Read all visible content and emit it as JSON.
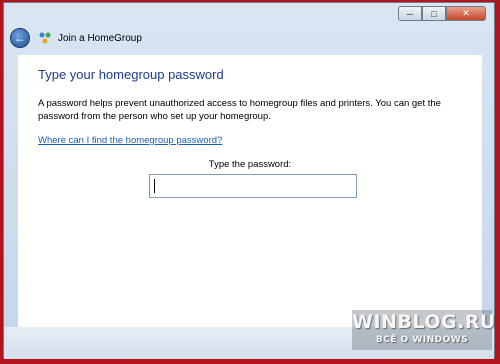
{
  "window": {
    "controls": {
      "minimize_icon": "minimize-icon",
      "maximize_icon": "maximize-icon",
      "close_icon": "close-icon"
    }
  },
  "nav": {
    "back_icon": "back-arrow-icon",
    "app_icon": "homegroup-icon",
    "title": "Join a HomeGroup"
  },
  "main": {
    "heading": "Type your homegroup password",
    "description": "A password helps prevent unauthorized access to homegroup files and printers.  You can get the password from the person who set up your homegroup.",
    "help_link": "Where can I find the homegroup password?",
    "password_label": "Type the password:",
    "password_value": ""
  },
  "watermark": {
    "title": "WINBLOG.RU",
    "subtitle": "ВСЁ О WINDOWS"
  },
  "colors": {
    "frame": "#b3131c",
    "heading": "#1e3b8a",
    "link": "#1a5fb4"
  }
}
